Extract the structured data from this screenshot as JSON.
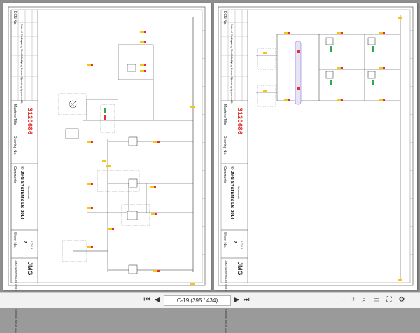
{
  "pages": [
    {
      "title_block": {
        "change_label": "ECN No.",
        "date_label": "Date of Change",
        "modified_label": "Drawing Modified By",
        "drawn_label": "Drawing Drawn By",
        "approved_label": "Drawing Approved By",
        "machine_title_label": "Machine Title",
        "drawing_no_label": "Drawing No.",
        "part_no": "3120686",
        "company": "© JMG SYSTEMS Ltd 2014",
        "comments_label": "Comments",
        "comments_value": "Schematic",
        "sheet_label": "Sheet No.",
        "sheet_value": "2",
        "sheet_of": "1 OF 3",
        "brand": "JMG",
        "address": "JMG Systems Ltd, Unit 9 Kestrel Park, Ampthill, MK45 2QJ"
      }
    },
    {
      "title_block": {
        "change_label": "ECN No.",
        "date_label": "Date of Change",
        "modified_label": "Drawing Modified By",
        "drawn_label": "Drawing Drawn By",
        "approved_label": "Drawing Approved By",
        "machine_title_label": "Machine Title",
        "drawing_no_label": "Drawing No.",
        "part_no": "3120686",
        "company": "© JMG SYSTEMS Ltd 2014",
        "comments_label": "Comments",
        "comments_value": "Schematic",
        "sheet_label": "Sheet No.",
        "sheet_value": "2",
        "sheet_of": "2 OF 3",
        "brand": "JMG",
        "address": "JMG Systems Ltd, Unit 9 Kestrel Park, Ampthill, MK45 2QJ"
      }
    }
  ],
  "toolbar": {
    "first_icon": "first-page-icon",
    "prev_icon": "previous-page-icon",
    "page_indicator": "C-19 (395 / 434)",
    "next_icon": "next-page-icon",
    "last_icon": "last-page-icon",
    "zoom_out_icon": "zoom-out-icon",
    "zoom_in_icon": "zoom-in-icon",
    "search_icon": "search-icon",
    "fit_icon": "fit-width-icon",
    "fullscreen_icon": "fullscreen-icon",
    "settings_icon": "settings-icon"
  }
}
